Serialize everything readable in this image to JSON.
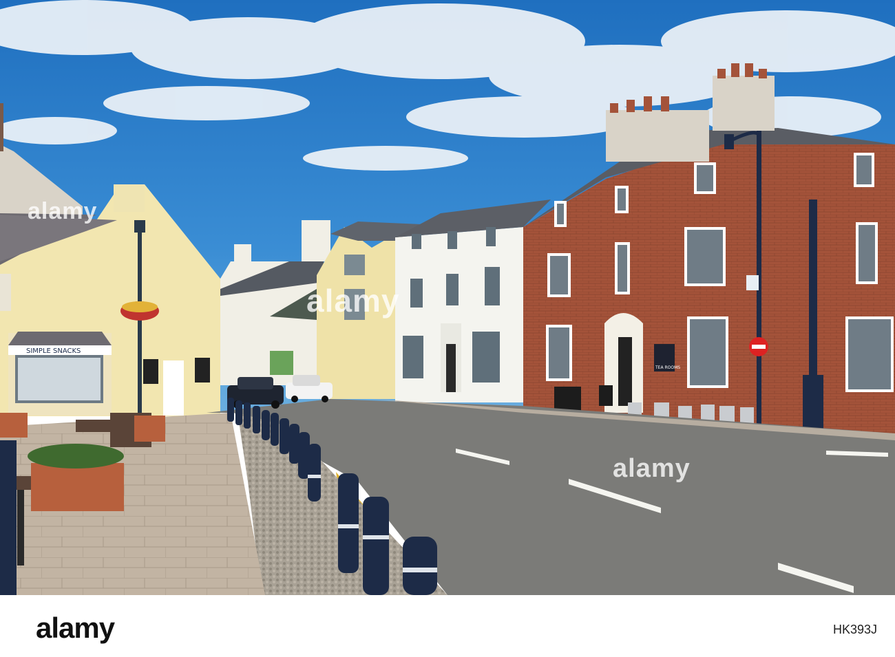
{
  "photo": {
    "shop_sign": "SIMPLE SNACKS",
    "tea_room_sign": "TEA ROOMS",
    "colors": {
      "sky": "#2f7fc6",
      "brick": "#a4533a",
      "cream_building": "#f2e6b0",
      "white_building": "#f4f4ef",
      "bollard": "#1d2b47",
      "road": "#7b7b78",
      "pavement": "#bfb1a0"
    }
  },
  "watermarks": {
    "center": "alamy",
    "left": "alamy",
    "right": "alamy"
  },
  "footer": {
    "logo": "alamy",
    "image_id": "HK393J"
  }
}
